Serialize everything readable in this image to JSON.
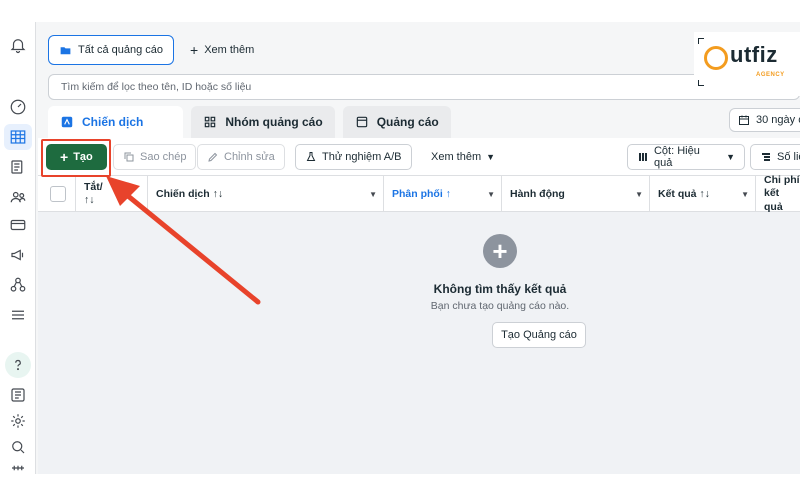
{
  "topbar": {
    "all_ads_label": "Tất cả quảng cáo",
    "see_more_label": "Xem thêm"
  },
  "search": {
    "placeholder": "Tìm kiếm để lọc theo tên, ID hoặc số liệu"
  },
  "tabs": [
    {
      "label": "Chiến dịch",
      "icon": "campaign-icon",
      "active": true
    },
    {
      "label": "Nhóm quảng cáo",
      "icon": "grid-icon",
      "active": false
    },
    {
      "label": "Quảng cáo",
      "icon": "ad-icon",
      "active": false
    }
  ],
  "date_range": {
    "label": "30 ngày c"
  },
  "toolbar": {
    "create_label": "Tạo",
    "duplicate_label": "Sao chép",
    "edit_label": "Chỉnh sửa",
    "ab_test_label": "Thử nghiệm A/B",
    "more_label": "Xem thêm",
    "columns_label": "Cột: Hiệu quả",
    "data_label": "Số liệ"
  },
  "table": {
    "columns": [
      {
        "label": "Tắt/",
        "sub": "↑↓"
      },
      {
        "label": "Chiến dịch ↑↓"
      },
      {
        "label": "Phân phối ↑"
      },
      {
        "label": "Hành động"
      },
      {
        "label": "Kết quả ↑↓"
      },
      {
        "label": "Chi phí",
        "sub": "kết quả"
      }
    ]
  },
  "empty_state": {
    "title": "Không tìm thấy kết quả",
    "subtitle": "Bạn chưa tạo quảng cáo nào.",
    "button_label": "Tạo Quảng cáo"
  },
  "logo": {
    "brand": "utfiz",
    "tagline": "AGENCY"
  },
  "colors": {
    "accent": "#1b74e4",
    "create_button": "#1e6b3f",
    "annotation": "#e8432b",
    "logo_orange": "#f39c1f"
  }
}
